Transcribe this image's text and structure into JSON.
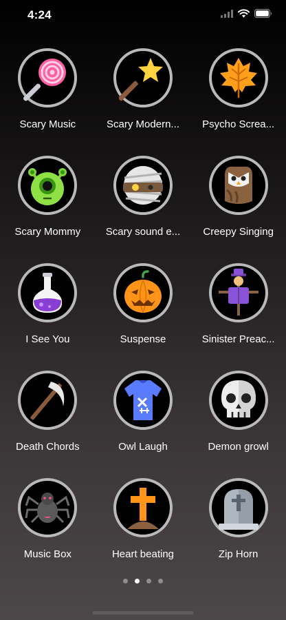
{
  "status_bar": {
    "time": "4:24"
  },
  "sounds": [
    {
      "label": "Scary Music",
      "icon": "lollipop-icon"
    },
    {
      "label": "Scary Modern...",
      "icon": "magic-wand-icon"
    },
    {
      "label": "Psycho Screa...",
      "icon": "autumn-leaf-icon"
    },
    {
      "label": "Scary Mommy",
      "icon": "alien-monster-icon"
    },
    {
      "label": "Scary sound e...",
      "icon": "mummy-icon"
    },
    {
      "label": "Creepy Singing",
      "icon": "owl-icon"
    },
    {
      "label": "I See You",
      "icon": "potion-flask-icon"
    },
    {
      "label": "Suspense",
      "icon": "jack-o-lantern-icon"
    },
    {
      "label": "Sinister Preac...",
      "icon": "scarecrow-icon"
    },
    {
      "label": "Death Chords",
      "icon": "scythe-icon"
    },
    {
      "label": "Owl Laugh",
      "icon": "zombie-shirt-icon"
    },
    {
      "label": "Demon growl",
      "icon": "skull-icon"
    },
    {
      "label": "Music Box",
      "icon": "spider-icon"
    },
    {
      "label": "Heart beating",
      "icon": "grave-cross-icon"
    },
    {
      "label": "Zip Horn",
      "icon": "tombstone-icon"
    }
  ],
  "pagination": {
    "pages": 4,
    "current": 2
  }
}
